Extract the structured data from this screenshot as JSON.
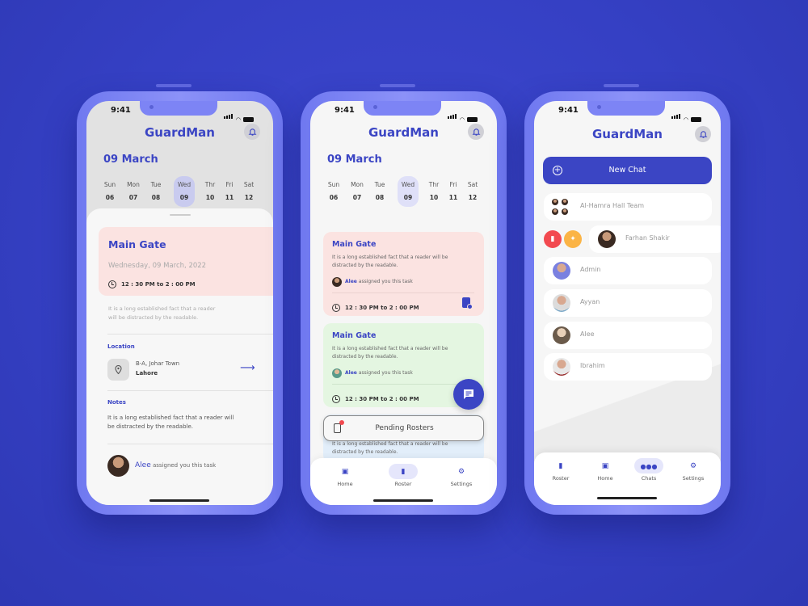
{
  "colors": {
    "brand": "#3b45c4",
    "background": "#3540c4",
    "frame": "#7d84f5",
    "pink_card": "#fbe3e1",
    "green_card": "#e4f6e1",
    "delete": "#f2494f",
    "pin": "#fbb446"
  },
  "status_bar": {
    "time": "9:41"
  },
  "app_title": "GuardMan",
  "calendar": {
    "month": "09 March",
    "days": [
      {
        "name": "Sun",
        "date": "06"
      },
      {
        "name": "Mon",
        "date": "07"
      },
      {
        "name": "Tue",
        "date": "08"
      },
      {
        "name": "Wed",
        "date": "09",
        "selected": true
      },
      {
        "name": "Thr",
        "date": "10"
      },
      {
        "name": "Fri",
        "date": "11"
      },
      {
        "name": "Sat",
        "date": "12"
      }
    ]
  },
  "detail": {
    "title": "Main Gate",
    "date": "Wednesday, 09 March, 2022",
    "time": "12 : 30 PM to 2 : 00 PM",
    "description": "It is a long established fact that a reader will be distracted by the readable.",
    "location_label": "Location",
    "address_line1": "B-A, Johar Town",
    "address_line2": "Lahore",
    "notes_label": "Notes",
    "notes": "It is a long established fact that a reader will be distracted by the readable.",
    "assigner": "Alee",
    "assigned_text": "assigned you this task"
  },
  "roster": {
    "tasks": [
      {
        "title": "Main Gate",
        "description": "It is a long established fact that a reader will be distracted by the readable.",
        "assigner": "Alee",
        "assigned_text": "assigned you this task",
        "time": "12 : 30 PM to 2 : 00 PM",
        "color": "#fbe3e1"
      },
      {
        "title": "Main Gate",
        "description": "It is a long established fact that a reader will be distracted by the readable.",
        "assigner": "Alee",
        "assigned_text": "assigned you this task",
        "time": "12 : 30 PM to 2 : 00 PM",
        "color": "#e4f6e1"
      }
    ],
    "partial_text": "It is a long established fact that a reader will be distracted by the readable.",
    "pending_label": "Pending Rosters",
    "nav": [
      {
        "label": "Home",
        "icon": "home-icon"
      },
      {
        "label": "Roster",
        "icon": "clipboard-icon",
        "active": true
      },
      {
        "label": "Settings",
        "icon": "gear-icon"
      }
    ]
  },
  "chats": {
    "new_chat_label": "New Chat",
    "items": [
      {
        "name": "Al-Hamra Hall Team",
        "group": true
      },
      {
        "name": "Farhan Shakir",
        "swiped": true
      },
      {
        "name": "Admin"
      },
      {
        "name": "Ayyan"
      },
      {
        "name": "Alee"
      },
      {
        "name": "Ibrahim"
      }
    ],
    "nav": [
      {
        "label": "Roster",
        "icon": "clipboard-icon"
      },
      {
        "label": "Home",
        "icon": "home-icon"
      },
      {
        "label": "Chats",
        "icon": "people-icon",
        "active": true
      },
      {
        "label": "Settings",
        "icon": "gear-icon"
      }
    ]
  }
}
